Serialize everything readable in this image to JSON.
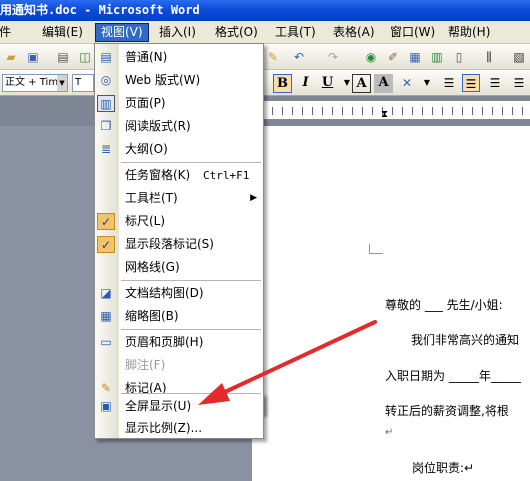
{
  "window": {
    "title": "用通知书.doc - Microsoft Word"
  },
  "menubar": {
    "items": [
      {
        "label": "编辑(E)"
      },
      {
        "label": "视图(V)"
      },
      {
        "label": "插入(I)"
      },
      {
        "label": "格式(O)"
      },
      {
        "label": "工具(T)"
      },
      {
        "label": "表格(A)"
      },
      {
        "label": "窗口(W)"
      },
      {
        "label": "帮助(H)"
      }
    ],
    "file_partial": "件"
  },
  "toolbar": {
    "style_combo": "正文 + Tim",
    "font_combo": "T",
    "bold": "B",
    "italic": "I",
    "underline": "U",
    "char_border": "A",
    "char_shade": "A"
  },
  "view_menu": {
    "items": [
      {
        "label": "普通(N)",
        "icon": "normal-view-icon"
      },
      {
        "label": "Web 版式(W)",
        "icon": "web-layout-icon"
      },
      {
        "label": "页面(P)",
        "icon": "print-layout-icon"
      },
      {
        "label": "阅读版式(R)",
        "icon": "reading-layout-icon"
      },
      {
        "label": "大纲(O)",
        "icon": "outline-view-icon"
      },
      {
        "label": "任务窗格(K)",
        "shortcut": "Ctrl+F1"
      },
      {
        "label": "工具栏(T)",
        "submenu": "▶"
      },
      {
        "label": "标尺(L)",
        "icon": "check-icon"
      },
      {
        "label": "显示段落标记(S)",
        "icon": "check-icon"
      },
      {
        "label": "网格线(G)"
      },
      {
        "label": "文档结构图(D)",
        "icon": "document-map-icon"
      },
      {
        "label": "缩略图(B)",
        "icon": "thumbnails-icon"
      },
      {
        "label": "页眉和页脚(H)",
        "icon": "header-footer-icon"
      },
      {
        "label": "脚注(F)",
        "disabled": true
      },
      {
        "label": "标记(A)",
        "icon": "markup-icon"
      },
      {
        "label": "全屏显示(U)",
        "icon": "full-screen-icon"
      },
      {
        "label": "显示比例(Z)..."
      }
    ]
  },
  "document": {
    "greeting": "尊敬的 ___ 先生/小姐:",
    "line2": "我们非常高兴的通知",
    "line3": "入职日期为 _____年_____",
    "line4": "转正后的薪资调整,将根",
    "line5": "岗位职责:↵",
    "return_mark": "↵"
  },
  "colors": {
    "menu_highlight": "#316ac5",
    "arrow": "#e32b2b",
    "title_bar": "#0a4ad8"
  }
}
